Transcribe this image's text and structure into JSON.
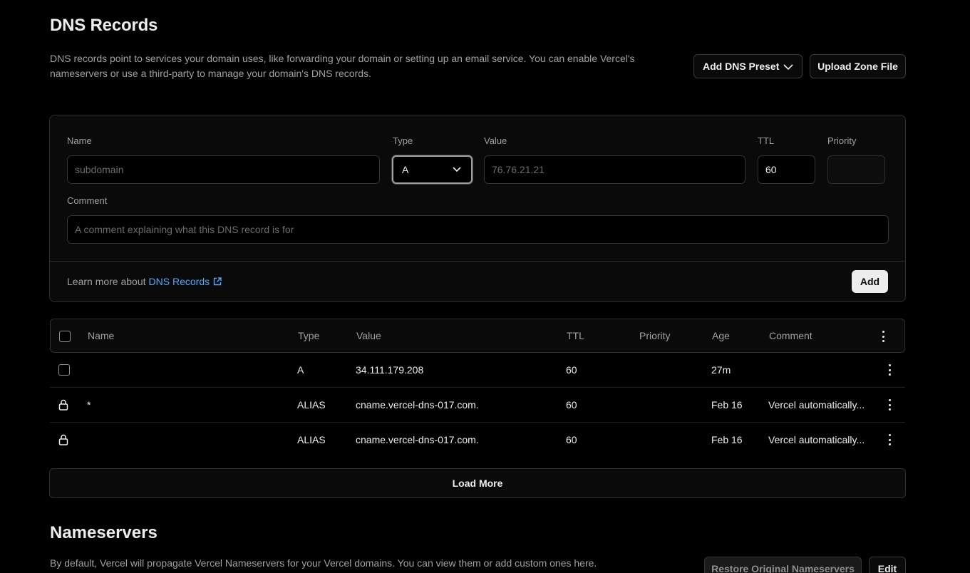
{
  "header": {
    "title": "DNS Records",
    "description": "DNS records point to services your domain uses, like forwarding your domain or setting up an email service. You can enable Vercel's nameservers or use a third-party to manage your domain's DNS records.",
    "add_preset_label": "Add DNS Preset",
    "upload_zone_label": "Upload Zone File"
  },
  "form": {
    "name_label": "Name",
    "name_placeholder": "subdomain",
    "type_label": "Type",
    "type_value": "A",
    "value_label": "Value",
    "value_placeholder": "76.76.21.21",
    "ttl_label": "TTL",
    "ttl_value": "60",
    "priority_label": "Priority",
    "comment_label": "Comment",
    "comment_placeholder": "A comment explaining what this DNS record is for",
    "learn_text": "Learn more about",
    "learn_link": "DNS Records",
    "add_label": "Add"
  },
  "table": {
    "columns": [
      "Name",
      "Type",
      "Value",
      "TTL",
      "Priority",
      "Age",
      "Comment"
    ],
    "rows": [
      {
        "name": "",
        "type": "A",
        "value": "34.111.179.208",
        "ttl": "60",
        "priority": "",
        "age": "27m",
        "comment": "",
        "locked": false
      },
      {
        "name": "*",
        "type": "ALIAS",
        "value": "cname.vercel-dns-017.com.",
        "ttl": "60",
        "priority": "",
        "age": "Feb 16",
        "comment": "Vercel automatically...",
        "locked": true
      },
      {
        "name": "",
        "type": "ALIAS",
        "value": "cname.vercel-dns-017.com.",
        "ttl": "60",
        "priority": "",
        "age": "Feb 16",
        "comment": "Vercel automatically...",
        "locked": true
      }
    ],
    "load_more_label": "Load More"
  },
  "nameservers": {
    "title": "Nameservers",
    "description": "By default, Vercel will propagate Vercel Nameservers for your Vercel domains. You can view them or add custom ones here.",
    "restore_label": "Restore Original Nameservers",
    "edit_label": "Edit"
  },
  "colors": {
    "background": "#000000",
    "link": "#52a8ff",
    "primary_button": "#ededed"
  }
}
